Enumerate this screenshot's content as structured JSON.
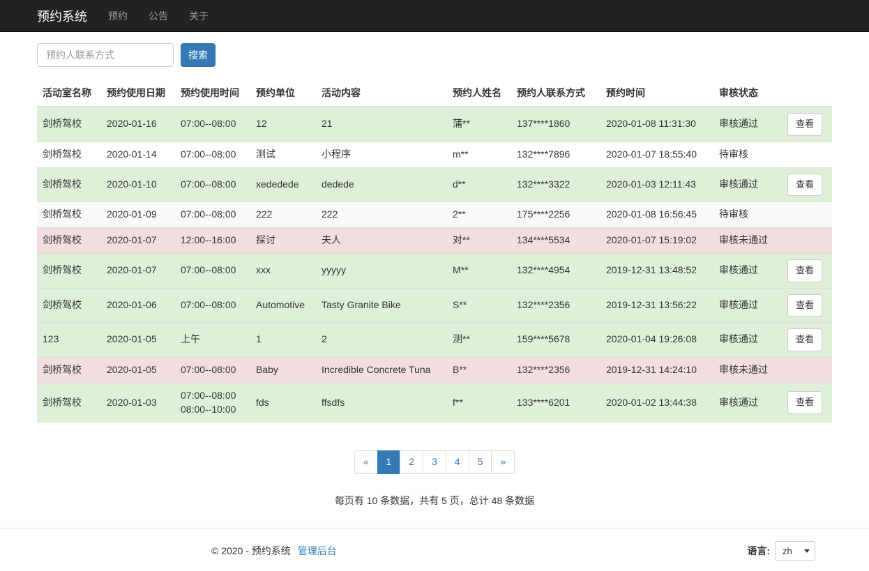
{
  "navbar": {
    "brand": "预约系统",
    "items": [
      {
        "name": "reserve",
        "label": "预约"
      },
      {
        "name": "notice",
        "label": "公告"
      },
      {
        "name": "about",
        "label": "关于"
      }
    ]
  },
  "search": {
    "placeholder": "预约人联系方式",
    "button_label": "搜索"
  },
  "table": {
    "headers": [
      "活动室名称",
      "预约使用日期",
      "预约使用时间",
      "预约单位",
      "活动内容",
      "预约人姓名",
      "预约人联系方式",
      "预约时间",
      "审核状态"
    ],
    "view_label": "查看",
    "rows": [
      {
        "room": "剑桥驾校",
        "date": "2020-01-16",
        "time": "07:00--08:00",
        "unit": "12",
        "content": "21",
        "name": "蒲**",
        "phone": "137****1860",
        "booked_at": "2020-01-08 11:31:30",
        "status": "审核通过",
        "variant": "success",
        "has_view": true
      },
      {
        "room": "剑桥驾校",
        "date": "2020-01-14",
        "time": "07:00--08:00",
        "unit": "测试",
        "content": "小程序",
        "name": "m**",
        "phone": "132****7896",
        "booked_at": "2020-01-07 18:55:40",
        "status": "待审核",
        "variant": "none",
        "has_view": false
      },
      {
        "room": "剑桥驾校",
        "date": "2020-01-10",
        "time": "07:00--08:00",
        "unit": "xededede",
        "content": "dedede",
        "name": "d**",
        "phone": "132****3322",
        "booked_at": "2020-01-03 12:11:43",
        "status": "审核通过",
        "variant": "success",
        "has_view": true
      },
      {
        "room": "剑桥驾校",
        "date": "2020-01-09",
        "time": "07:00--08:00",
        "unit": "222",
        "content": "222",
        "name": "2**",
        "phone": "175****2256",
        "booked_at": "2020-01-08 16:56:45",
        "status": "待审核",
        "variant": "striped",
        "has_view": false
      },
      {
        "room": "剑桥驾校",
        "date": "2020-01-07",
        "time": "12:00--16:00",
        "unit": "探讨",
        "content": "夫人",
        "name": "对**",
        "phone": "134****5534",
        "booked_at": "2020-01-07 15:19:02",
        "status": "审核未通过",
        "variant": "danger",
        "has_view": false
      },
      {
        "room": "剑桥驾校",
        "date": "2020-01-07",
        "time": "07:00--08:00",
        "unit": "xxx",
        "content": "yyyyy",
        "name": "M**",
        "phone": "132****4954",
        "booked_at": "2019-12-31 13:48:52",
        "status": "审核通过",
        "variant": "success",
        "has_view": true
      },
      {
        "room": "剑桥驾校",
        "date": "2020-01-06",
        "time": "07:00--08:00",
        "unit": "Automotive",
        "content": "Tasty Granite Bike",
        "name": "S**",
        "phone": "132****2356",
        "booked_at": "2019-12-31 13:56:22",
        "status": "审核通过",
        "variant": "success",
        "has_view": true
      },
      {
        "room": "123",
        "date": "2020-01-05",
        "time": "上午",
        "unit": "1",
        "content": "2",
        "name": "测**",
        "phone": "159****5678",
        "booked_at": "2020-01-04 19:26:08",
        "status": "审核通过",
        "variant": "success",
        "has_view": true
      },
      {
        "room": "剑桥驾校",
        "date": "2020-01-05",
        "time": "07:00--08:00",
        "unit": "Baby",
        "content": "Incredible Concrete Tuna",
        "name": "B**",
        "phone": "132****2356",
        "booked_at": "2019-12-31 14:24:10",
        "status": "审核未通过",
        "variant": "danger",
        "has_view": false
      },
      {
        "room": "剑桥驾校",
        "date": "2020-01-03",
        "time": "07:00--08:00\n08:00--10:00",
        "unit": "fds",
        "content": "ffsdfs",
        "name": "f**",
        "phone": "133****6201",
        "booked_at": "2020-01-02 13:44:38",
        "status": "审核通过",
        "variant": "success",
        "has_view": true
      }
    ]
  },
  "pagination": {
    "prev": "«",
    "next": "»",
    "prev_disabled": true,
    "pages": [
      "1",
      "2",
      "3",
      "4",
      "5"
    ],
    "active": "1"
  },
  "summary": "每页有 10 条数据，共有 5 页，总计 48 条数据",
  "footer": {
    "copyright": "© 2020 - 预约系统",
    "admin_link": "管理后台",
    "language_label": "语言:",
    "language_value": "zh"
  },
  "colors": {
    "navbar_bg": "#222222",
    "primary": "#337ab7",
    "success_row": "#dff0d8",
    "danger_row": "#f2dede",
    "striped_row": "#f9f9f9"
  }
}
